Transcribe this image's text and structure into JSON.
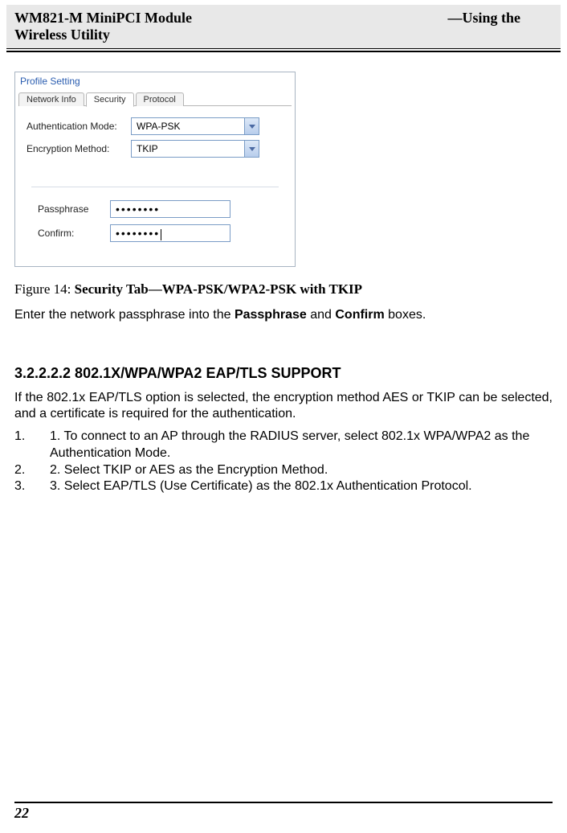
{
  "header": {
    "left_line1": "WM821-M MiniPCI Module",
    "left_line2": "Wireless Utility",
    "right": "—Using the"
  },
  "window": {
    "title": "Profile Setting",
    "tabs": [
      {
        "label": "Network Info",
        "active": false
      },
      {
        "label": "Security",
        "active": true
      },
      {
        "label": "Protocol",
        "active": false
      }
    ],
    "auth_label": "Authentication Mode:",
    "auth_value": "WPA-PSK",
    "enc_label": "Encryption Method:",
    "enc_value": "TKIP",
    "pass_label": "Passphrase",
    "pass_value": "••••••••",
    "confirm_label": "Confirm:",
    "confirm_value": "••••••••"
  },
  "figure": {
    "label": "Figure 14: ",
    "title": "Security Tab—WPA-PSK/WPA2-PSK with TKIP"
  },
  "text": {
    "passphrase_instruction_pre": "Enter the network passphrase into the ",
    "passphrase_word": "Passphrase",
    "and_word": " and ",
    "confirm_word": "Confirm",
    "passphrase_instruction_post": " boxes."
  },
  "section": {
    "number": "3.2.2.2.2 802.1X/WPA/WPA2 EAP/TLS SUPPORT",
    "para": "If the 802.1x EAP/TLS option is selected, the encryption method AES or TKIP can be selected, and a certificate is required for the authentication.",
    "items": [
      {
        "n": "1.",
        "t": "1. To connect to an AP through the RADIUS server, select 802.1x WPA/WPA2 as the Authentication Mode."
      },
      {
        "n": "2.",
        "t": "2. Select TKIP or AES as the Encryption Method."
      },
      {
        "n": "3.",
        "t": "3. Select EAP/TLS (Use Certificate) as the 802.1x Authentication Protocol."
      }
    ]
  },
  "footer": {
    "page": "22"
  }
}
